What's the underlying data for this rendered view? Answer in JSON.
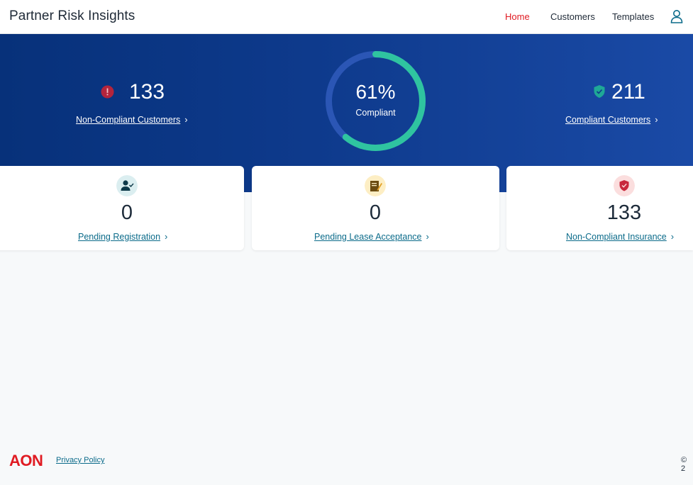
{
  "header": {
    "title": "Partner Risk Insights",
    "nav": [
      "Home",
      "Customers",
      "Templates"
    ],
    "active_nav": "Home",
    "user_icon": "user-icon"
  },
  "hero": {
    "non_compliant": {
      "count": "133",
      "link_label": "Non-Compliant Customers",
      "icon": "alert-icon",
      "icon_color": "#b3243c"
    },
    "compliant": {
      "count": "211",
      "link_label": "Compliant Customers",
      "icon": "shield-check-icon",
      "icon_color": "#1fa896"
    },
    "compliance": {
      "percent_text": "61%",
      "percent_value": 61,
      "label": "Compliant",
      "ring_color": "#2fc4a0",
      "track_color": "#2b56b5"
    }
  },
  "cards": [
    {
      "count": "0",
      "link_label": "Pending Registration",
      "icon": "user-check-icon",
      "icon_bg": "#dbeef0"
    },
    {
      "count": "0",
      "link_label": "Pending Lease Acceptance",
      "icon": "document-edit-icon",
      "icon_bg": "#fdeec4"
    },
    {
      "count": "133",
      "link_label": "Non-Compliant Insurance",
      "icon": "shield-alert-icon",
      "icon_bg": "#fbdede"
    }
  ],
  "footer": {
    "logo_text": "AON",
    "privacy_label": "Privacy Policy",
    "copyright": "© 2"
  },
  "colors": {
    "brand_red": "#e01b22",
    "hero_blue": "#0e3a8c",
    "link_teal": "#0b6b8a"
  }
}
